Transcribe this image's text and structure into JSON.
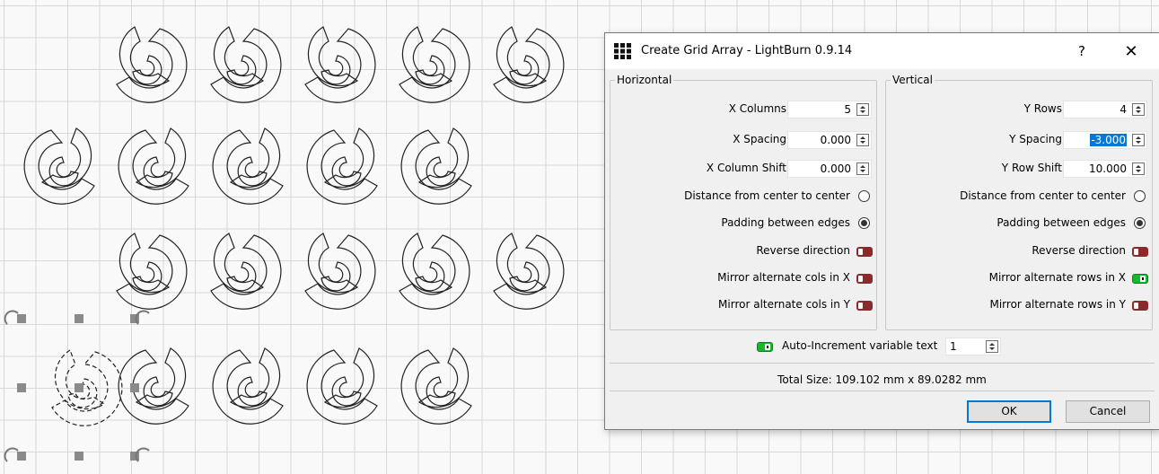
{
  "dialog": {
    "title": "Create Grid Array - LightBurn 0.9.14",
    "help_label": "?",
    "close_label": "✕",
    "horizontal": {
      "group_title": "Horizontal",
      "columns_label": "X Columns",
      "columns_value": "5",
      "spacing_label": "X Spacing",
      "spacing_value": "0.000",
      "shift_label": "X Column Shift",
      "shift_value": "0.000",
      "center_label": "Distance from center to center",
      "center_selected": false,
      "padding_label": "Padding between edges",
      "padding_selected": true,
      "reverse_label": "Reverse direction",
      "reverse_on": false,
      "mirror_x_label": "Mirror alternate cols in X",
      "mirror_x_on": false,
      "mirror_y_label": "Mirror alternate cols in Y",
      "mirror_y_on": false
    },
    "vertical": {
      "group_title": "Vertical",
      "rows_label": "Y Rows",
      "rows_value": "4",
      "spacing_label": "Y Spacing",
      "spacing_value": "-3.000",
      "shift_label": "Y Row Shift",
      "shift_value": "10.000",
      "center_label": "Distance from center to center",
      "center_selected": false,
      "padding_label": "Padding between edges",
      "padding_selected": true,
      "reverse_label": "Reverse direction",
      "reverse_on": false,
      "mirror_x_label": "Mirror alternate rows in X",
      "mirror_x_on": true,
      "mirror_y_label": "Mirror alternate rows in Y",
      "mirror_y_on": false
    },
    "auto_increment": {
      "label": "Auto-Increment variable text",
      "on": true,
      "value": "1"
    },
    "total_size": "Total Size: 109.102 mm x 89.0282 mm",
    "ok_label": "OK",
    "cancel_label": "Cancel"
  },
  "colors": {
    "toggle_off": "#8b2a2a",
    "toggle_on": "#18b82d",
    "selection": "#0078d7",
    "grid_line": "#d8d8d8"
  },
  "canvas": {
    "shape_icon": "c-swirl-shape",
    "selection_handles_icon": "rotate-handle-icon"
  }
}
